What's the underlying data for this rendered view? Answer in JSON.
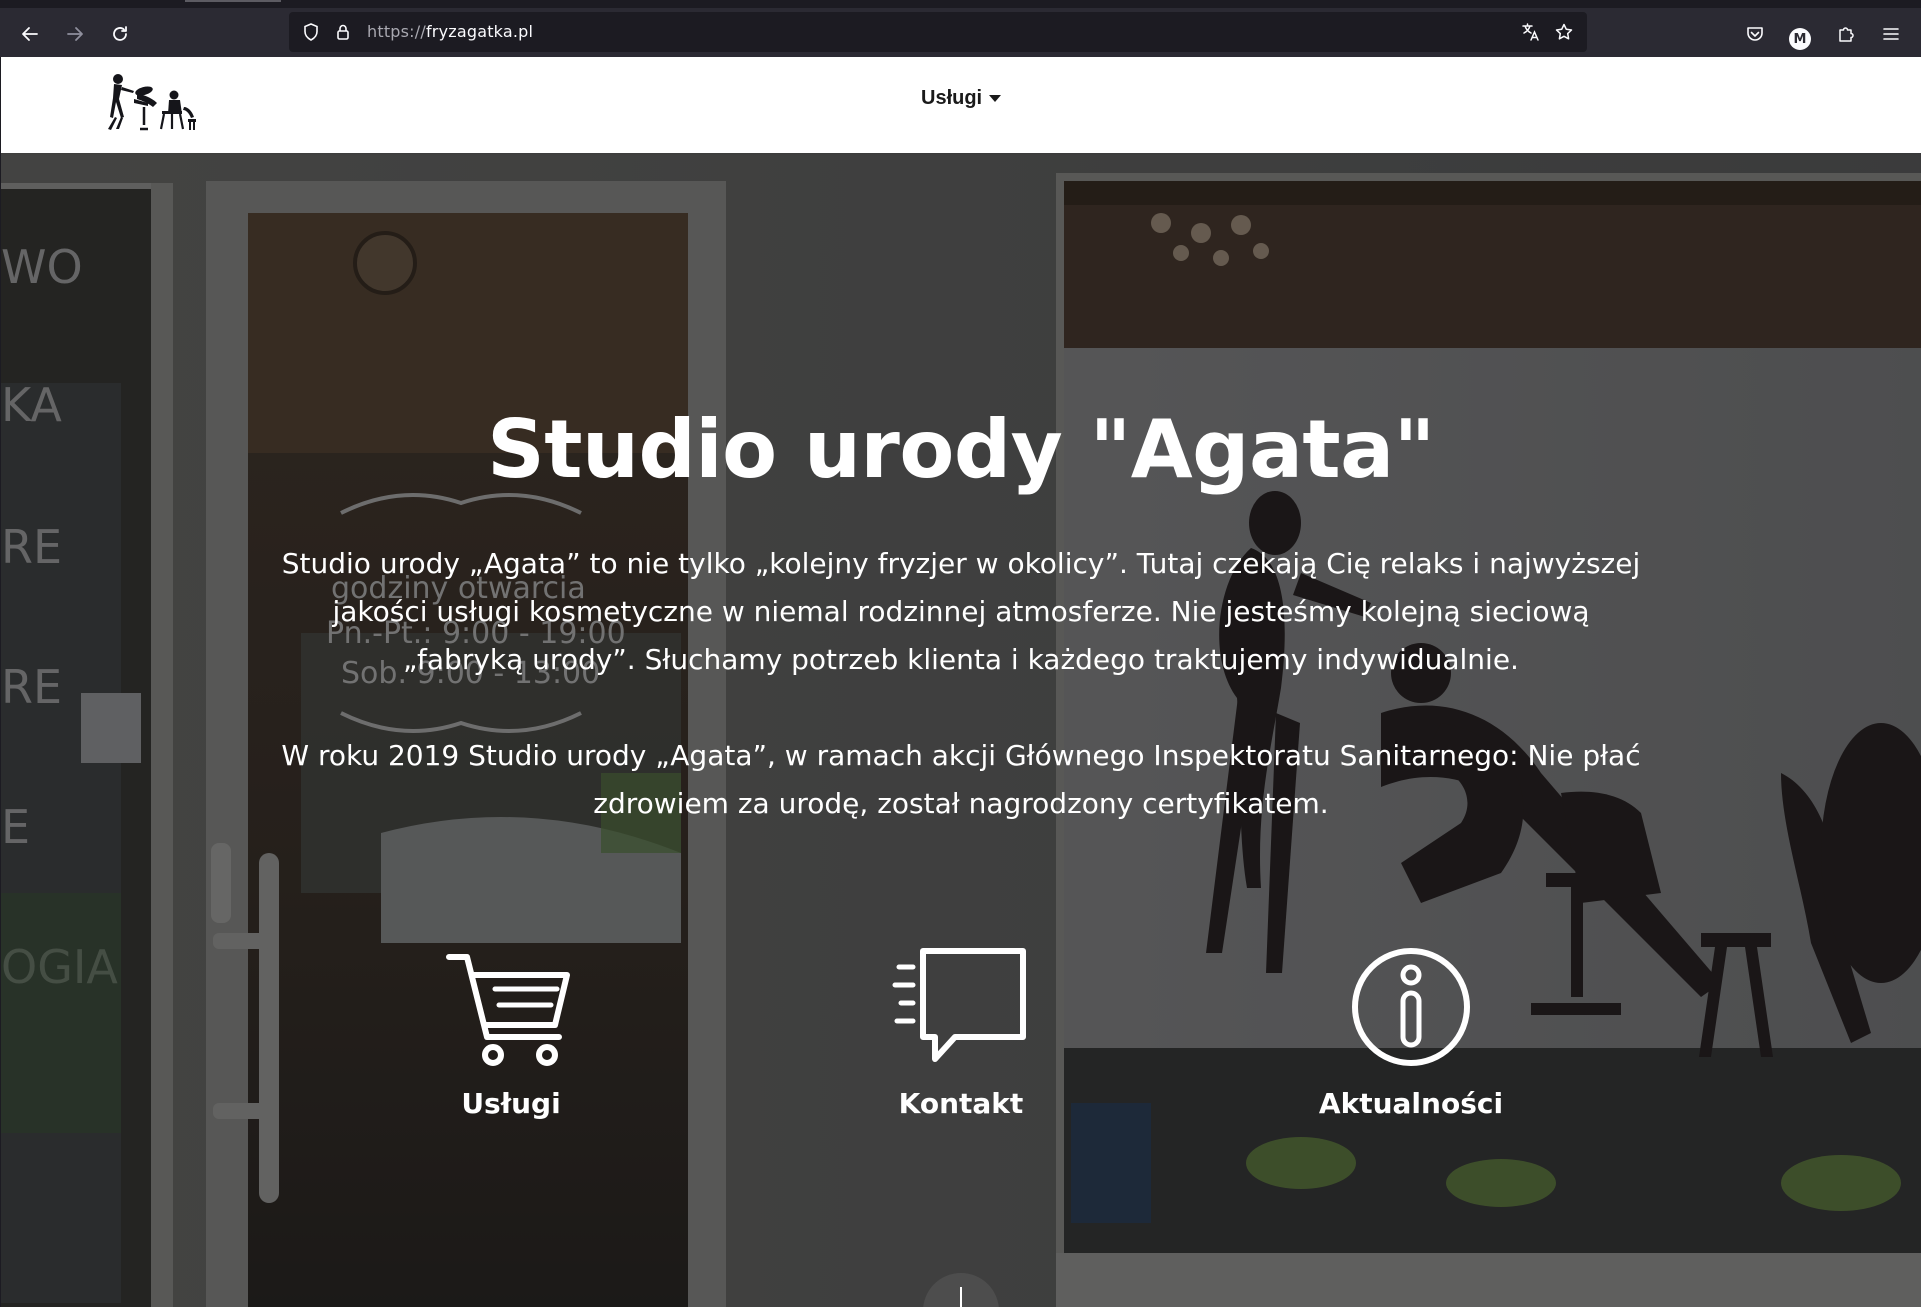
{
  "browser": {
    "url_protocol": "https://",
    "url_host": "fryzagatka.pl",
    "profile_initial": "M"
  },
  "header": {
    "nav_services_label": "Usługi"
  },
  "hero": {
    "title": "Studio urody \"Agata\"",
    "paragraph1": "Studio urody „Agata” to nie tylko „kolejny fryzjer w okolicy”. Tutaj czekają Cię relaks i najwyższej jakości usługi kosmetyczne w niemal rodzinnej atmosferze. Nie jesteśmy kolejną sieciową „fabryką urody”. Słuchamy potrzeb klienta i każdego traktujemy indywidualnie.",
    "paragraph2": "W roku 2019 Studio urody „Agata”, w ramach akcji Głównego Inspektoratu Sanitarnego: Nie płać zdrowiem za urodę, został nagrodzony certyfikatem.",
    "features": [
      {
        "label": "Usługi",
        "icon": "cart-icon"
      },
      {
        "label": "Kontakt",
        "icon": "chat-bubble-icon"
      },
      {
        "label": "Aktualności",
        "icon": "info-icon"
      }
    ]
  },
  "background_photo": {
    "door_sign_line1": "godziny otwarcia",
    "door_sign_line2": "Pn.-Pt.: 9:00 - 19:00",
    "door_sign_line3": "Sob. 9:00 - 13:00",
    "wall_text": [
      "WO",
      "KA",
      "RE",
      "RE",
      "E",
      "OGIA"
    ]
  },
  "colors": {
    "chrome_bg": "#2b2a33",
    "urlbar_bg": "#1c1b22",
    "hero_text": "#ffffff"
  }
}
